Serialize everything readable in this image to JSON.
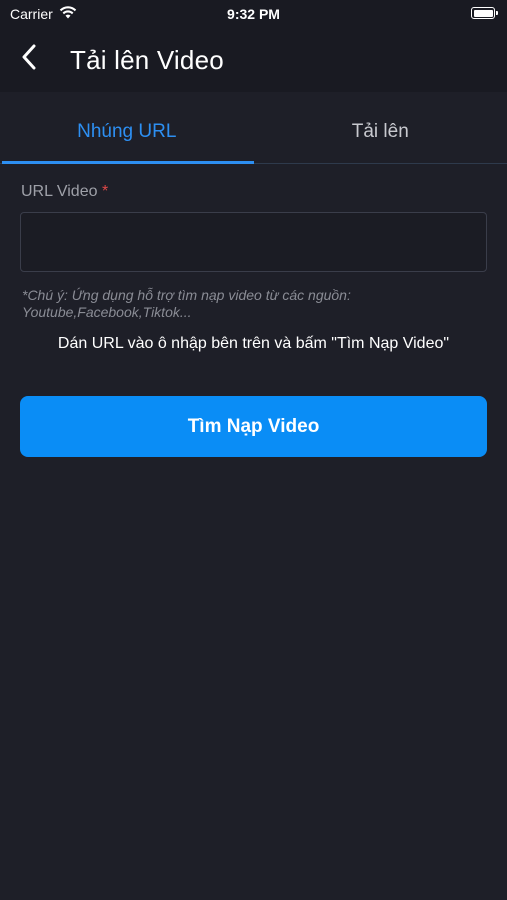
{
  "status_bar": {
    "carrier": "Carrier",
    "time": "9:32 PM",
    "battery_level": 1.0
  },
  "nav": {
    "back_icon": "chevron-left-icon",
    "title": "Tải lên Video"
  },
  "tabs": [
    {
      "label": "Nhúng URL",
      "active": true
    },
    {
      "label": "Tải lên",
      "active": false
    }
  ],
  "form": {
    "url_label": "URL Video",
    "required_mark": "*",
    "url_value": "",
    "url_placeholder": "",
    "hint_line1": "*Chú ý: Ứng dụng hỗ trợ tìm nạp video từ các nguồn:",
    "hint_line2": "Youtube,Facebook,Tiktok...",
    "instruction": "Dán URL vào ô nhập bên trên và bấm \"Tìm Nạp Video\"",
    "fetch_button_label": "Tìm Nạp Video"
  },
  "colors": {
    "background": "#1e1f28",
    "accent": "#2d8ff2",
    "button": "#0a8df6",
    "required": "#e04848"
  }
}
